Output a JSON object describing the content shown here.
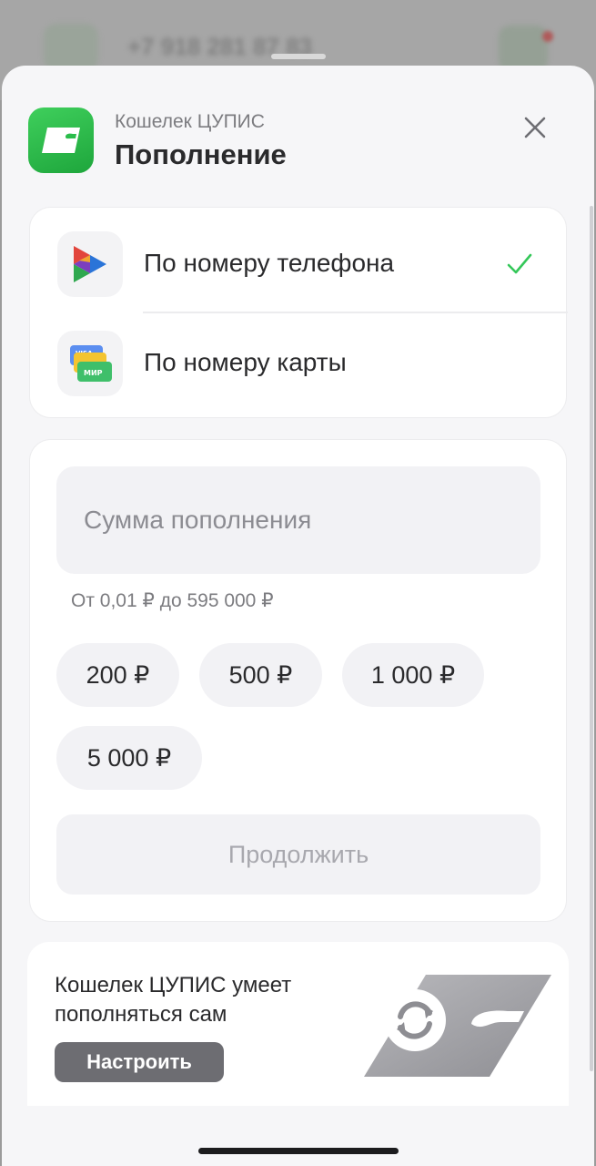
{
  "background": {
    "phone_number": "+7 918 281 87 83"
  },
  "header": {
    "subtitle": "Кошелек ЦУПИС",
    "title": "Пополнение"
  },
  "methods": [
    {
      "label": "По номеру телефона",
      "selected": true,
      "icon": "payment-system-logo-icon"
    },
    {
      "label": "По номеру карты",
      "selected": false,
      "icon": "bank-cards-icon"
    }
  ],
  "amount": {
    "placeholder": "Сумма пополнения",
    "value": "",
    "hint": "От 0,01 ₽ до 595 000 ₽",
    "chips": [
      "200 ₽",
      "500 ₽",
      "1 000 ₽",
      "5 000 ₽"
    ],
    "continue_label": "Продолжить"
  },
  "promo": {
    "text": "Кошелек ЦУПИС умеет пополняться сам",
    "button_label": "Настроить"
  },
  "colors": {
    "brand_green": "#2bbd4b",
    "check_green": "#34c759",
    "sheet_bg": "#f6f6f8"
  }
}
